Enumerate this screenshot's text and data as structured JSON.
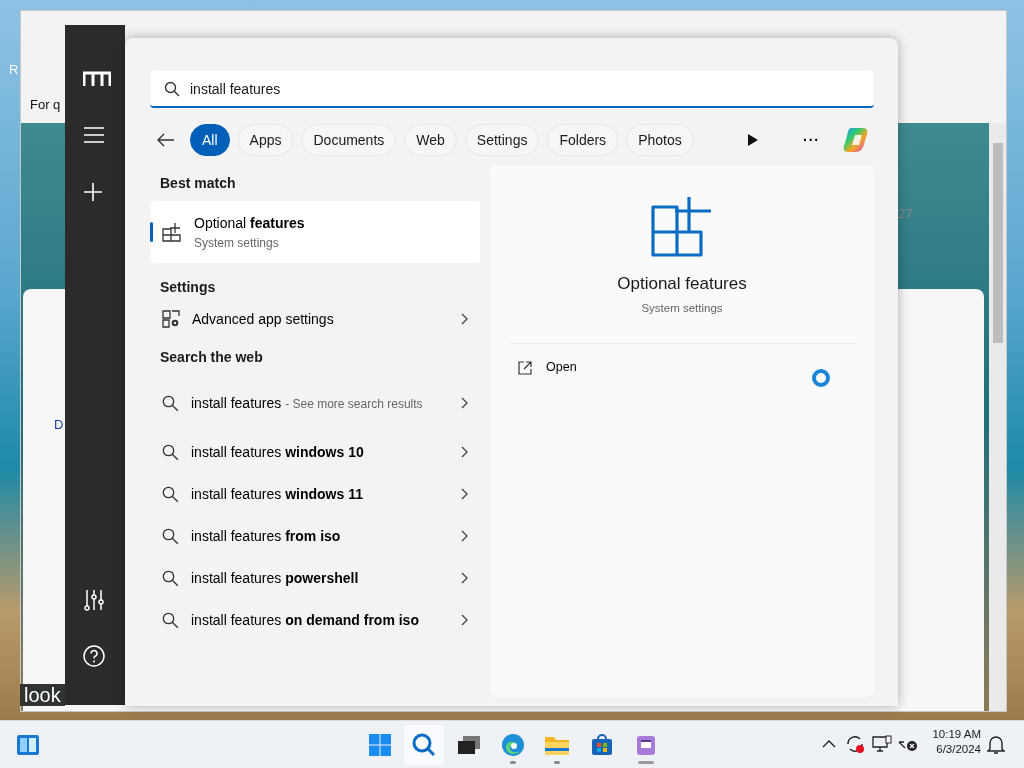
{
  "background_window": {
    "fragments": [
      "R",
      "For q",
      "D",
      "27",
      "look"
    ]
  },
  "search": {
    "value": "install features"
  },
  "filters": [
    {
      "label": "All",
      "selected": true
    },
    {
      "label": "Apps",
      "selected": false
    },
    {
      "label": "Documents",
      "selected": false
    },
    {
      "label": "Web",
      "selected": false
    },
    {
      "label": "Settings",
      "selected": false
    },
    {
      "label": "Folders",
      "selected": false
    },
    {
      "label": "Photos",
      "selected": false
    }
  ],
  "more_button": "···",
  "best_match": {
    "heading": "Best match",
    "title": "Optional **features**",
    "subtitle": "System settings",
    "selected": true
  },
  "settings_section": {
    "heading": "Settings",
    "items": [
      {
        "label": "Advanced app settings"
      }
    ]
  },
  "web_section": {
    "heading": "Search the web",
    "items": [
      {
        "text": "install features",
        "note": "- See more search results"
      },
      {
        "text": "install features **windows 10**"
      },
      {
        "text": "install features **windows 11**"
      },
      {
        "text": "install features **from iso**"
      },
      {
        "text": "install features **powershell**"
      },
      {
        "text": "install features **on demand from iso**"
      }
    ]
  },
  "preview": {
    "title": "Optional features",
    "subtitle": "System settings",
    "actions": [
      {
        "label": "Open"
      }
    ],
    "loading": true
  },
  "taskbar": {
    "apps": [
      {
        "kind": "start",
        "running": false,
        "active": false
      },
      {
        "kind": "search",
        "running": false,
        "active": true
      },
      {
        "kind": "taskview",
        "running": false,
        "active": false
      },
      {
        "kind": "edge",
        "running": true,
        "active": false
      },
      {
        "kind": "explorer",
        "running": true,
        "active": false
      },
      {
        "kind": "store",
        "running": false,
        "active": false
      },
      {
        "kind": "notepad",
        "running": true,
        "active": true
      }
    ],
    "time": "10:19 AM",
    "date": "6/3/2024"
  }
}
